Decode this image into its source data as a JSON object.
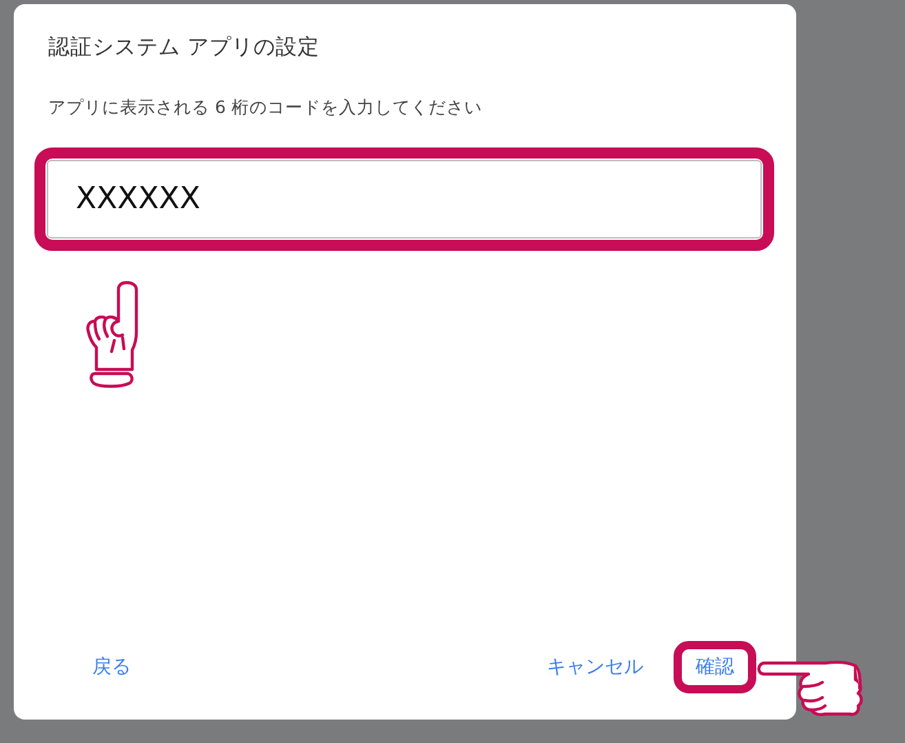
{
  "dialog": {
    "title": "認証システム アプリの設定",
    "instruction": "アプリに表示される 6 桁のコードを入力してください",
    "code_field": {
      "value": "XXXXXX",
      "highlighted": true
    },
    "buttons": [
      {
        "kind": "back",
        "label": "戻る",
        "highlighted": false
      },
      {
        "kind": "cancel",
        "label": "キャンセル",
        "highlighted": false
      },
      {
        "kind": "confirm",
        "label": "確認",
        "highlighted": true
      }
    ]
  }
}
